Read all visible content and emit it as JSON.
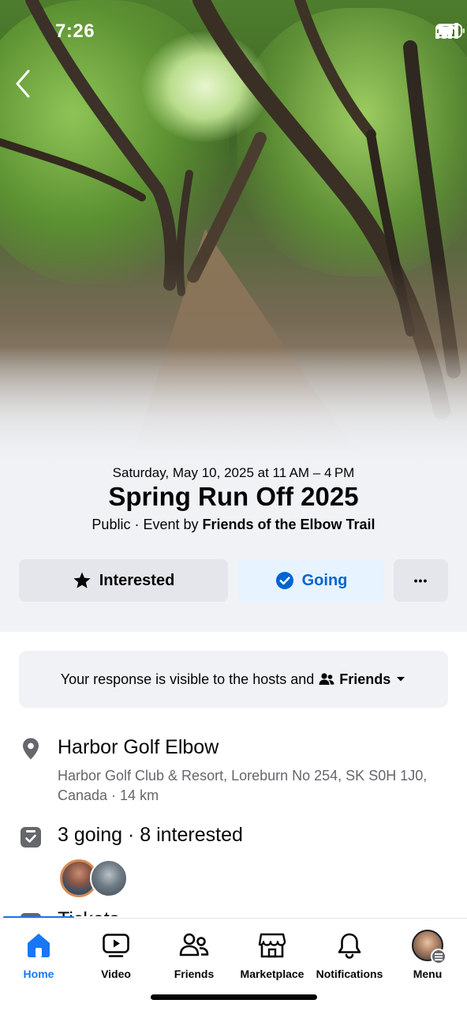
{
  "status_bar": {
    "time": "7:26"
  },
  "event": {
    "date_line": "Saturday, May 10, 2025 at 11 AM – 4 PM",
    "title": "Spring Run Off 2025",
    "privacy": "Public",
    "event_by_prefix": "Event by",
    "host": "Friends of the Elbow Trail"
  },
  "actions": {
    "interested_label": "Interested",
    "going_label": "Going",
    "more_label": "•••"
  },
  "notice": {
    "text": "Your response is visible to the hosts and",
    "audience": "Friends"
  },
  "location": {
    "name": "Harbor Golf Elbow",
    "address": "Harbor Golf Club & Resort, Loreburn No 254, SK S0H 1J0, Canada · 14 km"
  },
  "attendance": {
    "summary": "3 going · 8 interested"
  },
  "tickets": {
    "label": "Tickets"
  },
  "bottom_nav": {
    "active": "home",
    "items": [
      {
        "id": "home",
        "label": "Home",
        "icon": "home-icon"
      },
      {
        "id": "video",
        "label": "Video",
        "icon": "video-icon"
      },
      {
        "id": "friends",
        "label": "Friends",
        "icon": "friends-icon"
      },
      {
        "id": "marketplace",
        "label": "Marketplace",
        "icon": "marketplace-icon"
      },
      {
        "id": "notifications",
        "label": "Notifications",
        "icon": "bell-icon"
      },
      {
        "id": "menu",
        "label": "Menu",
        "icon": "profile-avatar"
      }
    ]
  },
  "colors": {
    "brand_blue": "#1877f2",
    "going_bg": "#e7f3ff",
    "going_text": "#0064d1",
    "secondary_button": "#e4e6eb",
    "muted_text": "#65676b"
  }
}
